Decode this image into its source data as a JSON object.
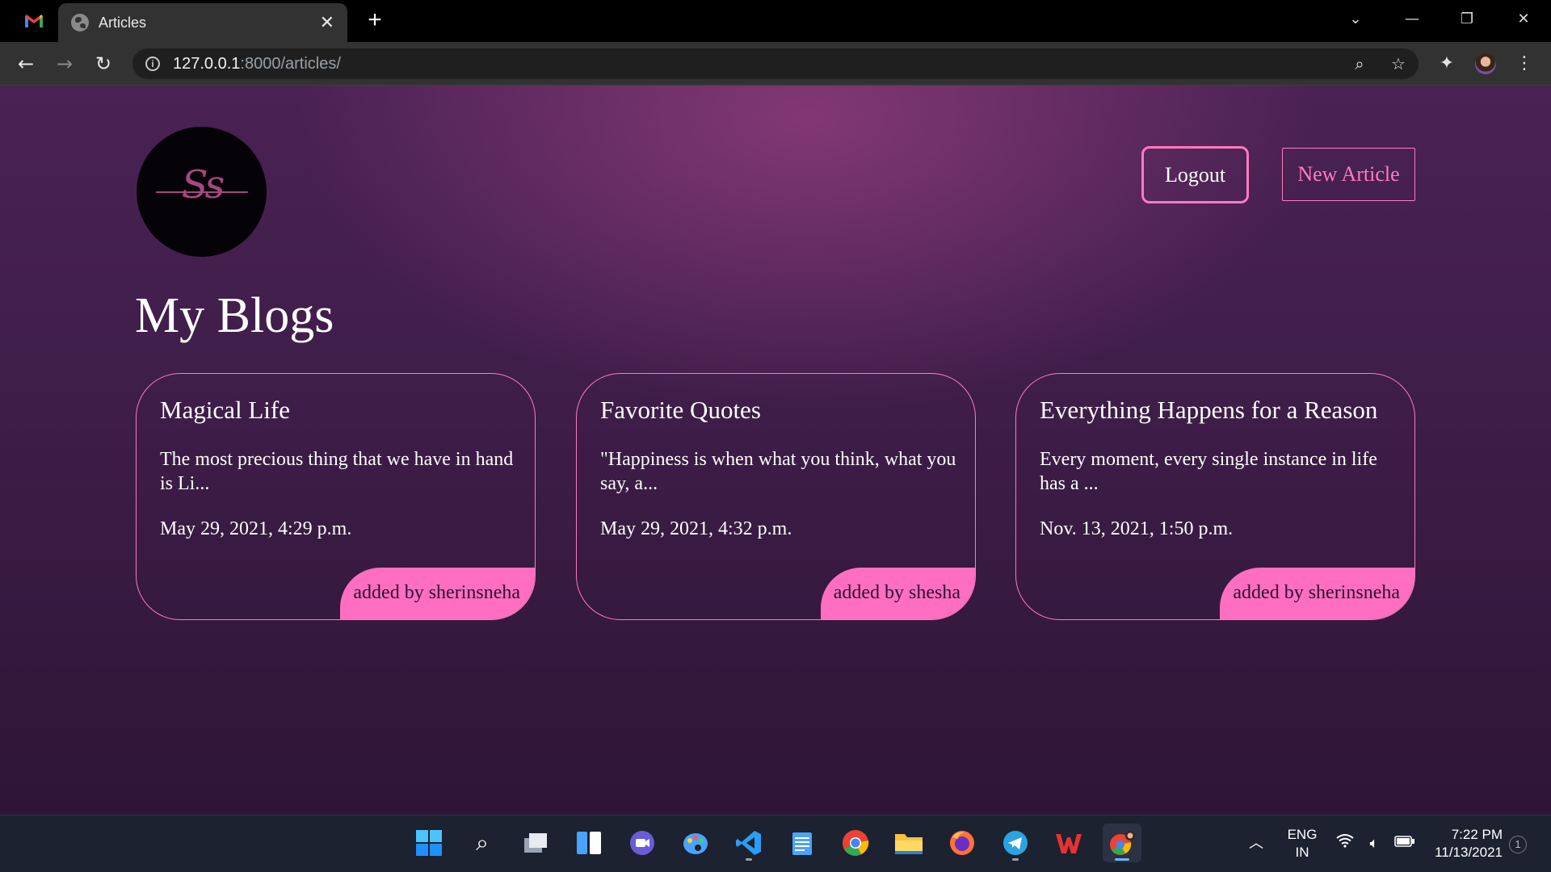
{
  "browser": {
    "tab_title": "Articles",
    "tab_close": "✕",
    "new_tab": "+",
    "url_host": "127.0.0.1",
    "url_rest": ":8000/articles/"
  },
  "page": {
    "logo_text": "Ss",
    "heading": "My Blogs",
    "logout_label": "Logout",
    "new_article_label": "New Article",
    "accent_color": "#ff7ac0"
  },
  "articles": [
    {
      "title": "Magical Life",
      "snippet": "The most precious thing that we have in hand is Li...",
      "date": "May 29, 2021, 4:29 p.m.",
      "author": "added by sherinsneha"
    },
    {
      "title": "Favorite Quotes",
      "snippet": "\"Happiness is when what you think, what you say, a...",
      "date": "May 29, 2021, 4:32 p.m.",
      "author": "added by shesha"
    },
    {
      "title": "Everything Happens for a Reason",
      "snippet": "Every moment, every single instance in life has a ...",
      "date": "Nov. 13, 2021, 1:50 p.m.",
      "author": "added by sherinsneha"
    }
  ],
  "taskbar": {
    "lang_line1": "ENG",
    "lang_line2": "IN",
    "time": "7:22 PM",
    "date": "11/13/2021",
    "notifications": "1"
  }
}
